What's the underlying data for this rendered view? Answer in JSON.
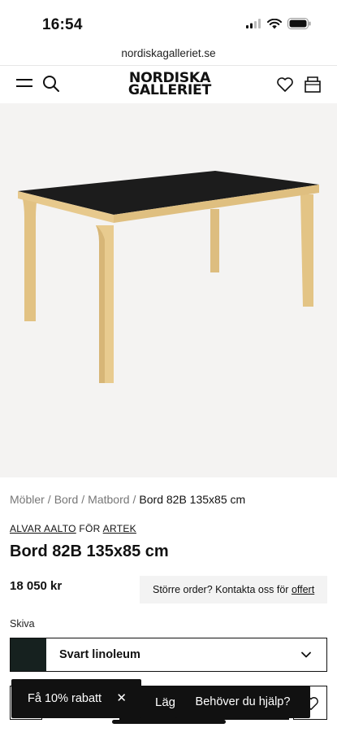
{
  "status": {
    "time": "16:54"
  },
  "browser": {
    "url": "nordiskagalleriet.se"
  },
  "header": {
    "logo_line1": "NORDISKA",
    "logo_line2": "GALLERIET"
  },
  "breadcrumb": {
    "items": [
      "Möbler",
      "Bord",
      "Matbord"
    ],
    "separator": "/",
    "current": "Bord 82B 135x85 cm"
  },
  "product": {
    "designer": "ALVAR AALTO",
    "for_label": "FÖR",
    "brand": "ARTEK",
    "title": "Bord 82B 135x85 cm",
    "price": "18 050 kr",
    "order_text": "Större order? Kontakta oss för",
    "order_link": "offert"
  },
  "option": {
    "label": "Skiva",
    "selected": "Svart linoleum",
    "swatch_color": "#16211f"
  },
  "actions": {
    "add_label": "Lägg",
    "discount_label": "Få 10% rabatt",
    "discount_close": "✕",
    "help_label": "Behöver du hjälp?"
  },
  "colors": {
    "table_top": "#1c1c1c",
    "birch": "#e7c98d",
    "image_bg": "#f4f3f2"
  }
}
